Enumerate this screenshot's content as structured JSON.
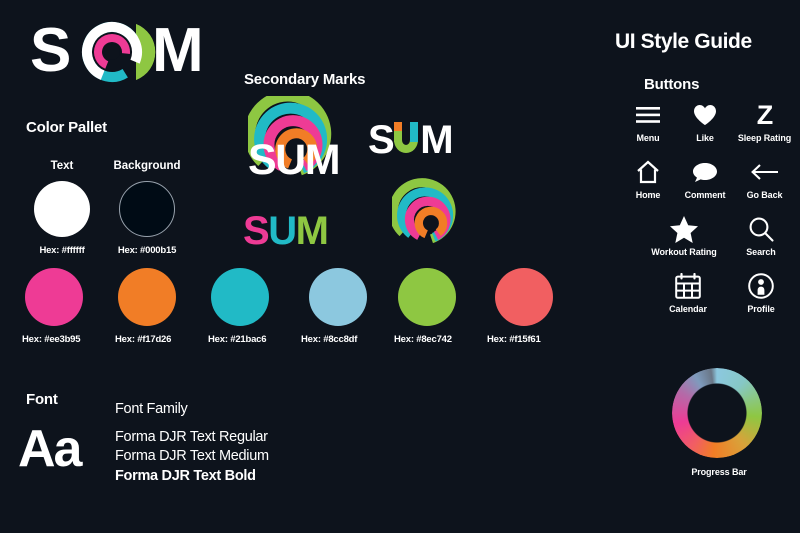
{
  "theme": {
    "background": "#000b15",
    "canvas": "#0d131c",
    "text": "#ffffff"
  },
  "brand": {
    "wordmark": "SUM",
    "letters": {
      "s": "S",
      "u": "U",
      "m": "M"
    },
    "arc_colors": {
      "green": "#8ec742",
      "cyan": "#21bac6",
      "magenta": "#ee3b95",
      "orange": "#f17d26",
      "white": "#ffffff",
      "lightblue": "#8cc8df",
      "coral": "#f15f61"
    }
  },
  "color_pallet": {
    "title": "Color Pallet",
    "base": [
      {
        "name": "Text",
        "label": "Text",
        "hex_label": "Hex: #ffffff",
        "hex": "#ffffff",
        "style": "filled"
      },
      {
        "name": "Background",
        "label": "Background",
        "hex_label": "Hex: #000b15",
        "hex": "#000b15",
        "style": "outline"
      }
    ],
    "swatches": [
      {
        "hex": "#ee3b95",
        "hex_label": "Hex: #ee3b95"
      },
      {
        "hex": "#f17d26",
        "hex_label": "Hex: #f17d26"
      },
      {
        "hex": "#21bac6",
        "hex_label": "Hex: #21bac6"
      },
      {
        "hex": "#8cc8df",
        "hex_label": "Hex: #8cc8df"
      },
      {
        "hex": "#8ec742",
        "hex_label": "Hex: #8ec742"
      },
      {
        "hex": "#f15f61",
        "hex_label": "Hex: #f15f61"
      }
    ]
  },
  "secondary_marks": {
    "title": "Secondary Marks",
    "marks": [
      {
        "name": "stacked-arc-wordmark",
        "wordmark": "SUM"
      },
      {
        "name": "white-wordmark-colored-u",
        "wordmark": "SUM"
      },
      {
        "name": "colored-wordmark",
        "wordmark": "SUM"
      },
      {
        "name": "arc-only-mark",
        "wordmark": ""
      }
    ]
  },
  "font": {
    "title": "Font",
    "specimen": "Aa",
    "family_label": "Font Family",
    "weights": [
      "Forma DJR Text Regular",
      "Forma DJR Text Medium",
      "Forma DJR Text Bold"
    ]
  },
  "ui_style_guide": {
    "title": "UI Style Guide",
    "buttons_title": "Buttons",
    "icons": [
      {
        "icon": "menu-icon",
        "label": "Menu"
      },
      {
        "icon": "heart-icon",
        "label": "Like"
      },
      {
        "icon": "z-icon",
        "label": "Sleep Rating"
      },
      {
        "icon": "home-icon",
        "label": "Home"
      },
      {
        "icon": "comment-icon",
        "label": "Comment"
      },
      {
        "icon": "arrow-left-icon",
        "label": "Go Back"
      },
      {
        "icon": "star-icon",
        "label": "Workout Rating"
      },
      {
        "icon": "search-icon",
        "label": "Search"
      },
      {
        "icon": "calendar-icon",
        "label": "Calendar"
      },
      {
        "icon": "profile-icon",
        "label": "Profile"
      }
    ],
    "progress_bar": {
      "label": "Progress Bar"
    }
  }
}
